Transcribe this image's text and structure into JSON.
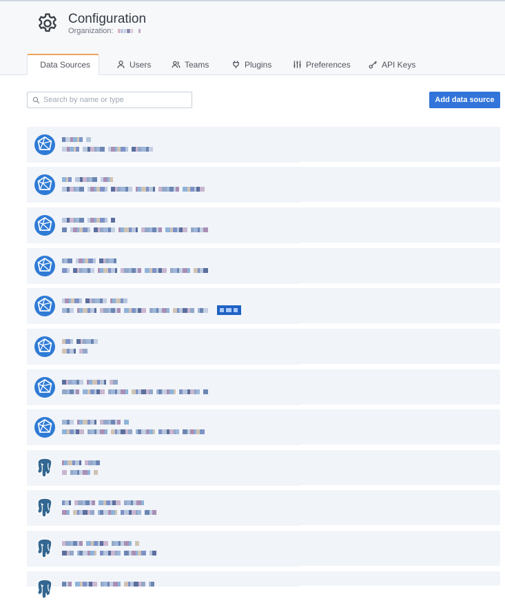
{
  "header": {
    "title": "Configuration",
    "org_label": "Organization:"
  },
  "tabs": [
    {
      "label": "Data Sources",
      "icon": "database-icon",
      "active": true
    },
    {
      "label": "Users",
      "icon": "user-icon",
      "active": false
    },
    {
      "label": "Teams",
      "icon": "users-icon",
      "active": false
    },
    {
      "label": "Plugins",
      "icon": "plug-icon",
      "active": false
    },
    {
      "label": "Preferences",
      "icon": "sliders-icon",
      "active": false
    },
    {
      "label": "API Keys",
      "icon": "key-icon",
      "active": false
    }
  ],
  "search": {
    "placeholder": "Search by name or type",
    "value": ""
  },
  "add_button": {
    "label": "Add data source"
  },
  "colors": {
    "accent": "#3274d9",
    "active_tab_border": "#f0a35a",
    "card_bg": "#f1f4f9",
    "prometheus_icon": "#2f7bd6",
    "postgres_icon": "#336791"
  },
  "datasources": [
    {
      "icon": "prometheus-icon",
      "badge": false
    },
    {
      "icon": "prometheus-icon",
      "badge": false
    },
    {
      "icon": "prometheus-icon",
      "badge": false
    },
    {
      "icon": "prometheus-icon",
      "badge": false
    },
    {
      "icon": "prometheus-icon",
      "badge": true
    },
    {
      "icon": "prometheus-icon",
      "badge": false
    },
    {
      "icon": "prometheus-icon",
      "badge": false
    },
    {
      "icon": "prometheus-icon",
      "badge": false
    },
    {
      "icon": "postgresql-icon",
      "badge": false
    },
    {
      "icon": "postgresql-icon",
      "badge": false
    },
    {
      "icon": "postgresql-icon",
      "badge": false
    },
    {
      "icon": "postgresql-icon",
      "badge": false
    }
  ]
}
